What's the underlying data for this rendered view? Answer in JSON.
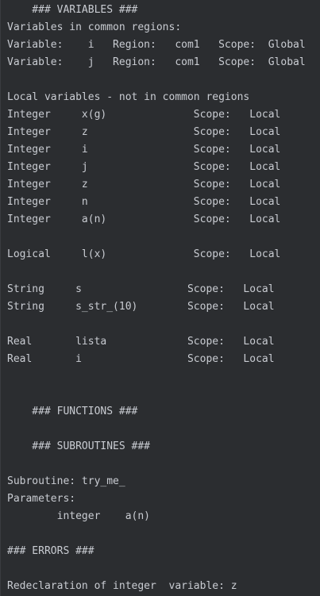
{
  "console": {
    "lines": [
      "    ### VARIABLES ###",
      "Variables in common regions:",
      "Variable:    i   Region:   com1   Scope:  Global",
      "Variable:    j   Region:   com1   Scope:  Global",
      "",
      "Local variables - not in common regions",
      "Integer     x(g)              Scope:   Local",
      "Integer     z                 Scope:   Local",
      "Integer     i                 Scope:   Local",
      "Integer     j                 Scope:   Local",
      "Integer     z                 Scope:   Local",
      "Integer     n                 Scope:   Local",
      "Integer     a(n)              Scope:   Local",
      "",
      "Logical     l(x)              Scope:   Local",
      "",
      "String     s                 Scope:   Local",
      "String     s_str_(10)        Scope:   Local",
      "",
      "Real       lista             Scope:   Local",
      "Real       i                 Scope:   Local",
      "",
      "",
      "    ### FUNCTIONS ###",
      "",
      "    ### SUBROUTINES ###",
      "",
      "Subroutine: try_me_",
      "Parameters:",
      "        integer    a(n)",
      "",
      "### ERRORS ###",
      "",
      "Redeclaration of integer  variable: z"
    ]
  }
}
